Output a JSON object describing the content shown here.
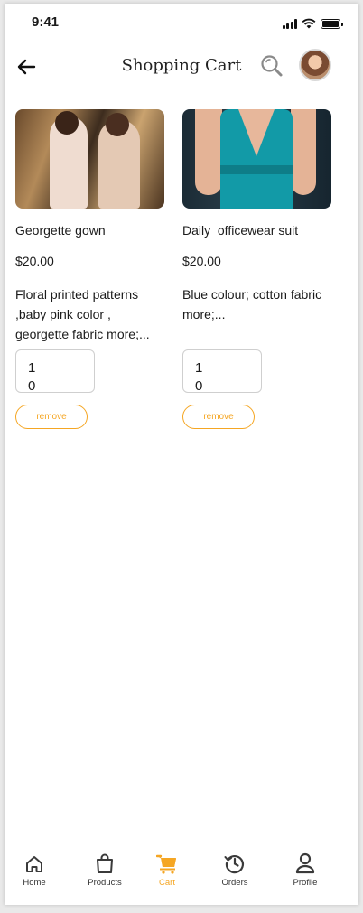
{
  "status_bar": {
    "time": "9:41"
  },
  "header": {
    "title": "Shopping Cart"
  },
  "cart_items": [
    {
      "name": "Georgette gown",
      "price": "$20.00",
      "description": "Floral printed patterns ,baby pink color , georgette fabric more;...",
      "quantity": "10",
      "remove_label": "remove"
    },
    {
      "name": "Daily  officewear suit",
      "price": "$20.00",
      "description": "Blue colour; cotton fabric more;...",
      "quantity": "10",
      "remove_label": "remove"
    }
  ],
  "bottom_nav": {
    "items": [
      {
        "label": "Home",
        "icon": "home-icon"
      },
      {
        "label": "Products",
        "icon": "shopping-bag-icon"
      },
      {
        "label": "Cart",
        "icon": "cart-icon",
        "active": true
      },
      {
        "label": "Orders",
        "icon": "history-clock-icon"
      },
      {
        "label": "Profile",
        "icon": "user-icon"
      }
    ]
  },
  "colors": {
    "accent": "#f5a623",
    "text": "#1b1b1b",
    "border": "#cfcfcf"
  }
}
